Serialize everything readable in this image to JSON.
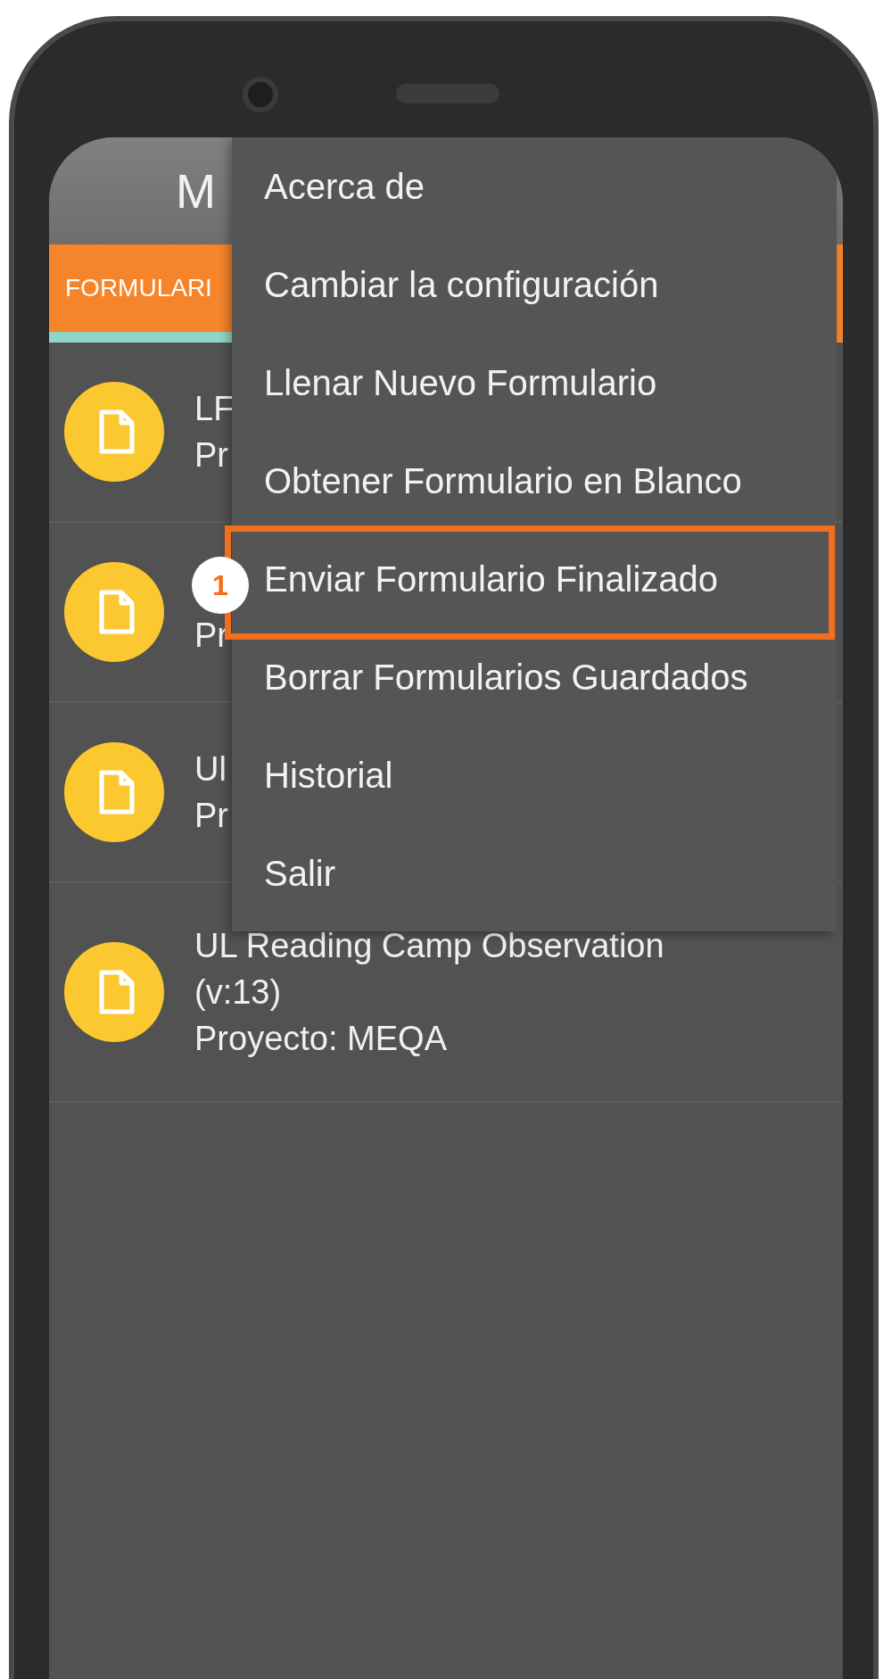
{
  "app_bar": {
    "title": "M"
  },
  "tabs": [
    {
      "label": "FORMULARI",
      "selected": true
    }
  ],
  "forms": [
    {
      "title": "LF",
      "subtitle": "Pr"
    },
    {
      "subtitle": "Pr"
    },
    {
      "title": "Ul",
      "subtitle": "Pr"
    },
    {
      "title": "UL Reading Camp Observation (v:13)",
      "subtitle": "Proyecto: MEQA"
    }
  ],
  "menu": {
    "items": [
      {
        "label": "Acerca de",
        "highlighted": false
      },
      {
        "label": "Cambiar la configuración",
        "highlighted": false
      },
      {
        "label": "Llenar Nuevo Formulario",
        "highlighted": false
      },
      {
        "label": "Obtener Formulario en Blanco",
        "highlighted": false
      },
      {
        "label": "Enviar Formulario Finalizado",
        "highlighted": true,
        "callout": "1"
      },
      {
        "label": "Borrar Formularios Guardados",
        "highlighted": false
      },
      {
        "label": "Historial",
        "highlighted": false
      },
      {
        "label": "Salir",
        "highlighted": false
      }
    ]
  }
}
